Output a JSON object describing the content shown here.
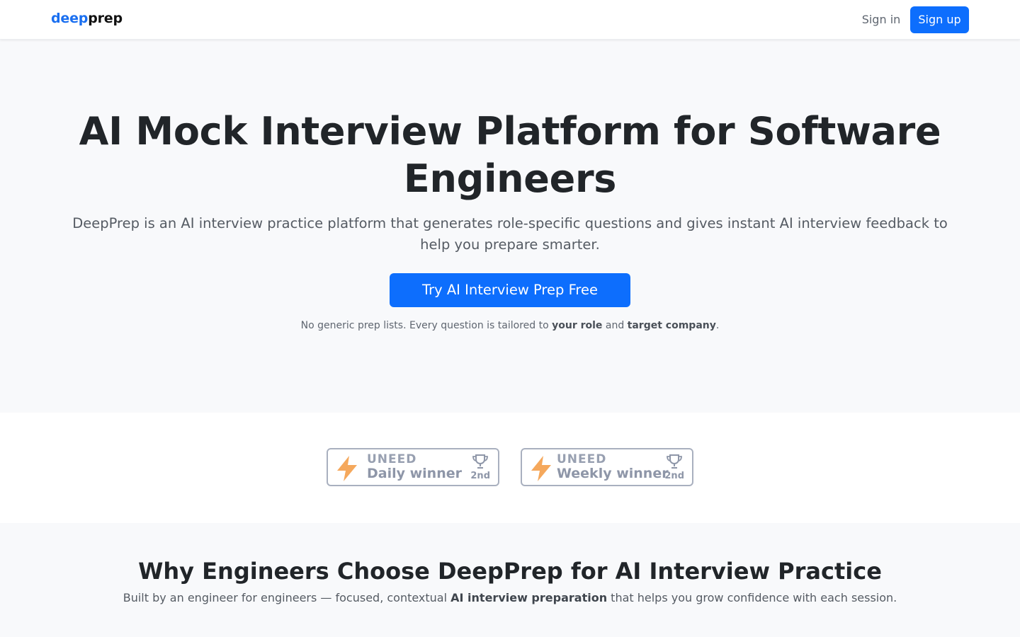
{
  "nav": {
    "brand_part1": "deep",
    "brand_part2": "prep",
    "sign_in": "Sign in",
    "sign_up": "Sign up"
  },
  "hero": {
    "title_line1": "AI Mock Interview Platform for Software",
    "title_line2": "Engineers",
    "subtitle": "DeepPrep is an AI interview practice platform that generates role-specific questions and gives instant AI interview feedback to help you prepare smarter.",
    "cta": "Try AI Interview Prep Free",
    "note_prefix": "No generic prep lists. Every question is tailored to ",
    "note_bold1": "your role",
    "note_mid": " and ",
    "note_bold2": "target company",
    "note_suffix": "."
  },
  "badges": [
    {
      "brand": "UNEED",
      "title": "Daily winner",
      "place": "2nd"
    },
    {
      "brand": "UNEED",
      "title": "Weekly winner",
      "place": "2nd"
    }
  ],
  "why": {
    "title": "Why Engineers Choose DeepPrep for AI Interview Practice",
    "sub_prefix": "Built by an engineer for engineers — focused, contextual ",
    "sub_bold": "AI interview preparation",
    "sub_suffix": " that helps you grow confidence with each session."
  },
  "colors": {
    "primary": "#0d6efd",
    "brand_blue": "#1a6ff0",
    "bolt_orange": "#f5a85c",
    "badge_gray": "#8e96a8"
  }
}
